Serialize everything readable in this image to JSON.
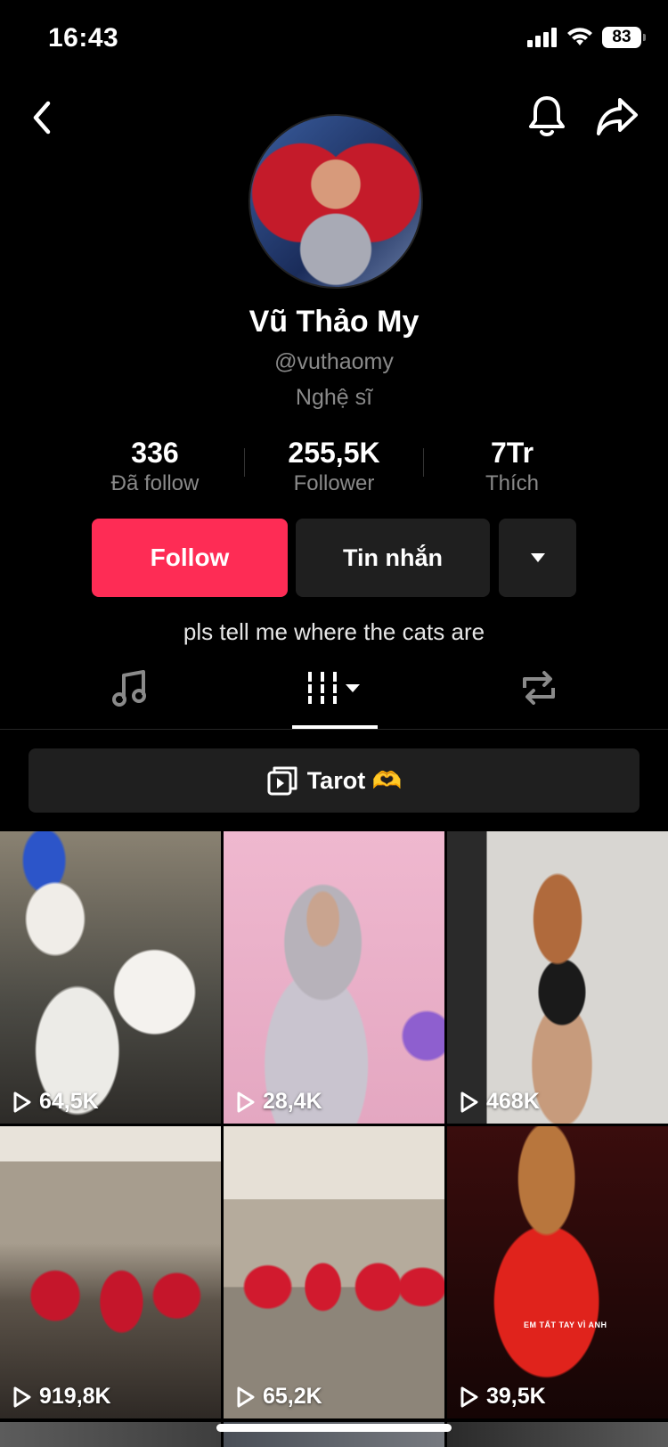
{
  "status_bar": {
    "time": "16:43",
    "battery": "83"
  },
  "profile": {
    "display_name": "Vũ Thảo My",
    "username": "@vuthaomy",
    "category": "Nghệ sĩ",
    "bio": "pls tell me where the cats are"
  },
  "stats": [
    {
      "value": "336",
      "label": "Đã follow"
    },
    {
      "value": "255,5K",
      "label": "Follower"
    },
    {
      "value": "7Tr",
      "label": "Thích"
    }
  ],
  "actions": {
    "follow": "Follow",
    "message": "Tin nhắn"
  },
  "playlist": {
    "label": "Tarot 🫶"
  },
  "videos": [
    {
      "views": "64,5K"
    },
    {
      "views": "28,4K"
    },
    {
      "views": "468K"
    },
    {
      "views": "919,8K"
    },
    {
      "views": "65,2K"
    },
    {
      "views": "39,5K"
    }
  ],
  "video6_caption": "EM TẤT TAY VÌ ANH",
  "colors": {
    "accent": "#fe2c55",
    "button_dark": "#1f1f1f",
    "muted_text": "#8a8a8a"
  },
  "icons": [
    "back-icon",
    "bell-icon",
    "share-icon",
    "music-icon",
    "grid-icon",
    "repost-icon",
    "playlist-icon",
    "play-icon"
  ]
}
